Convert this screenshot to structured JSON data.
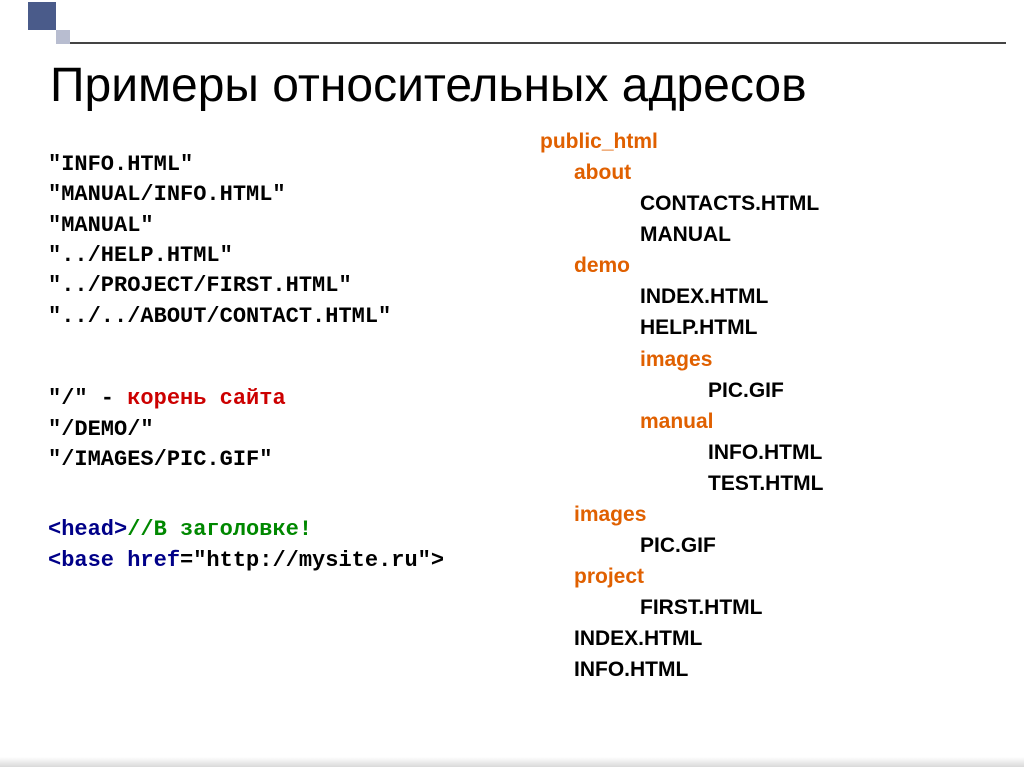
{
  "title": "Примеры относительных адресов",
  "left": {
    "paths": [
      "\"info.html\"",
      "\"manual/info.html\"",
      "\"manual\"",
      "\"../help.html\"",
      "\"../project/first.html\"",
      "\"../../about/contact.html\""
    ],
    "root_prefix": "\"/\" - ",
    "root_label": "корень сайта",
    "root_examples": [
      "\"/demo/\"",
      "\"/images/pic.gif\""
    ],
    "code_line1_open": "<head>",
    "code_line1_comment": "//В заголовке!",
    "code_line2_open": "<base href",
    "code_line2_rest": "=\"http://mysite.ru\">"
  },
  "tree": {
    "root": "public_html",
    "items": [
      {
        "level": 1,
        "text": "about",
        "folder": true
      },
      {
        "level": 2,
        "text": "CONTACTS.HTML",
        "folder": false
      },
      {
        "level": 2,
        "text": "MANUAL",
        "folder": false
      },
      {
        "level": 1,
        "text": "demo",
        "folder": true
      },
      {
        "level": 2,
        "text": "INDEX.HTML",
        "folder": false
      },
      {
        "level": 2,
        "text": "HELP.HTML",
        "folder": false
      },
      {
        "level": 2,
        "text": "images",
        "folder": true
      },
      {
        "level": 3,
        "text": "PIC.GIF",
        "folder": false
      },
      {
        "level": 2,
        "text": "manual",
        "folder": true
      },
      {
        "level": 3,
        "text": "INFO.HTML",
        "folder": false
      },
      {
        "level": 3,
        "text": "TEST.HTML",
        "folder": false
      },
      {
        "level": 1,
        "text": "images",
        "folder": true
      },
      {
        "level": 2,
        "text": "PIC.GIF",
        "folder": false
      },
      {
        "level": 1,
        "text": "project",
        "folder": true
      },
      {
        "level": 2,
        "text": "FIRST.HTML",
        "folder": false
      },
      {
        "level": 1,
        "text": "INDEX.HTML",
        "folder": false
      },
      {
        "level": 1,
        "text": "INFO.HTML",
        "folder": false
      }
    ]
  }
}
